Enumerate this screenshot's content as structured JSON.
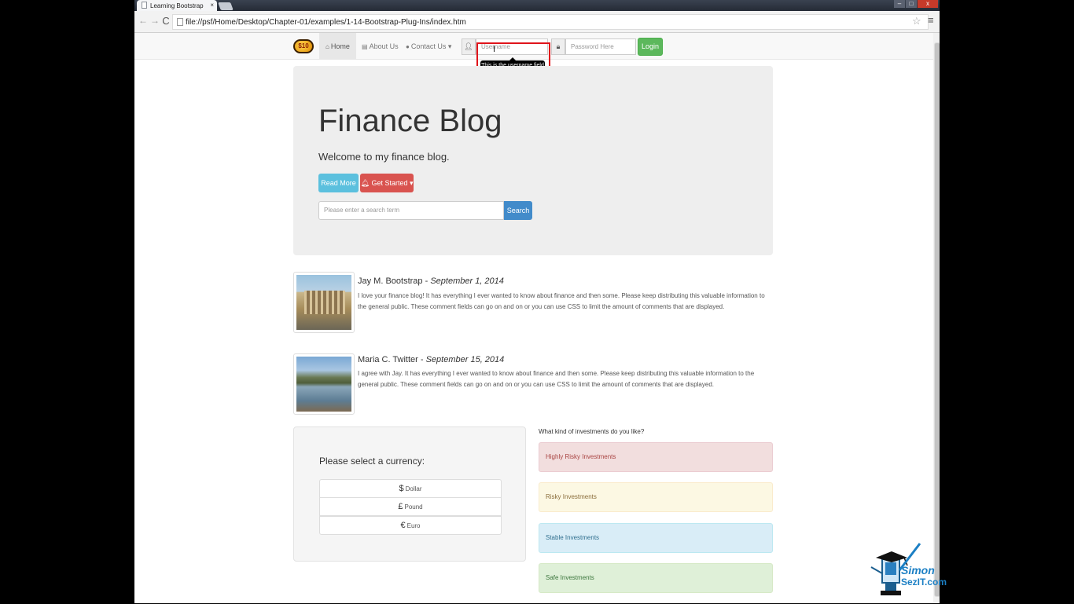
{
  "browser": {
    "tab_title": "Learning Bootstrap",
    "tab_close": "×",
    "url": "file://psf/Home/Desktop/Chapter-01/examples/1-14-Bootstrap-Plug-Ins/index.htm",
    "back": "←",
    "forward": "→",
    "reload": "C",
    "star": "☆",
    "menu": "≡",
    "window_controls": {
      "minimize": "–",
      "maximize": "□",
      "close": "x"
    }
  },
  "navbar": {
    "brand": "$10",
    "items": [
      {
        "label": "Home",
        "icon": "home-icon"
      },
      {
        "label": "About Us",
        "icon": "book-icon"
      },
      {
        "label": "Contact Us",
        "icon": "question-circle-icon",
        "caret": "▾"
      }
    ],
    "username_placeholder": "Username",
    "password_placeholder": "Password Here",
    "login_label": "Login",
    "tooltip": "This is the username field"
  },
  "jumbotron": {
    "title": "Finance Blog",
    "lead": "Welcome to my finance blog.",
    "read_more": "Read More",
    "get_started": "Get Started",
    "search_placeholder": "Please enter a search term",
    "search_button": "Search"
  },
  "comments": [
    {
      "author": "Jay M. Bootstrap",
      "date": "September 1, 2014",
      "body": "I love your finance blog! It has everything I ever wanted to know about finance and then some. Please keep distributing this valuable information to the general public. These comment fields can go on and on or you can use CSS to limit the amount of comments that are displayed."
    },
    {
      "author": "Maria C. Twitter",
      "date": "September 15, 2014",
      "body": "I agree with Jay. It has everything I ever wanted to know about finance and then some. Please keep distributing this valuable information to the general public. These comment fields can go on and on or you can use CSS to limit the amount of comments that are displayed."
    }
  ],
  "currency": {
    "heading": "Please select a currency:",
    "options": [
      {
        "symbol": "$",
        "label": "Dollar"
      },
      {
        "symbol": "£",
        "label": "Pound"
      },
      {
        "symbol": "€",
        "label": "Euro"
      }
    ]
  },
  "investments": {
    "question": "What kind of investments do you like?",
    "options": [
      {
        "label": "Highly Risky Investments",
        "color": "#a94442"
      },
      {
        "label": "Risky Investments",
        "color": "#8a6d3b"
      },
      {
        "label": "Stable Investments",
        "color": "#31708f"
      },
      {
        "label": "Safe Investments",
        "color": "#3c763d"
      }
    ]
  },
  "watermark": {
    "line1": "Simon",
    "line2": "SezIT.com"
  }
}
